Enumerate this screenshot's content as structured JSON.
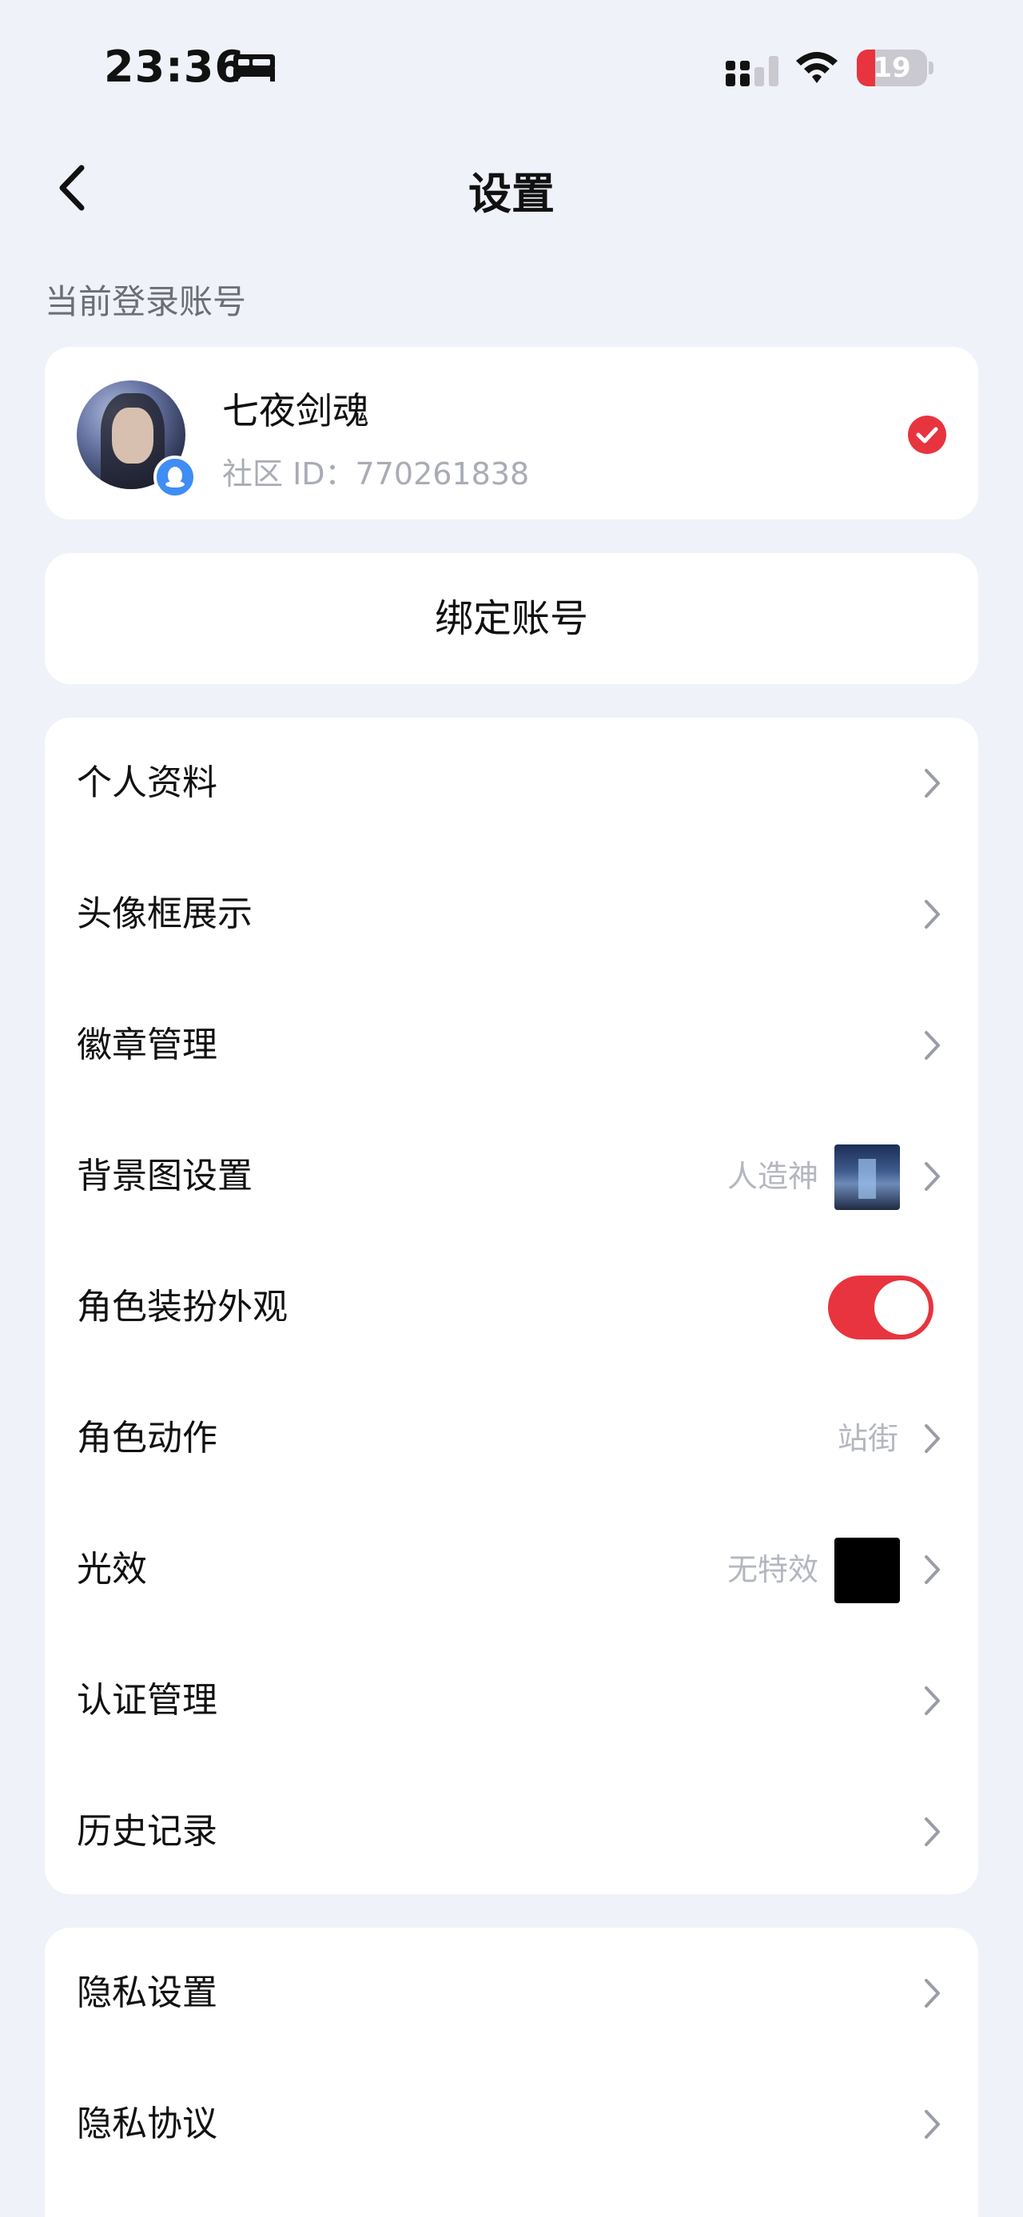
{
  "status_bar": {
    "time": "23:36",
    "battery": "19",
    "battery_level_percent": 19,
    "sleep_icon": "bed-icon",
    "cellular_icon": "cellular-signal-icon",
    "wifi_icon": "wifi-icon"
  },
  "header": {
    "title": "设置",
    "back_icon": "chevron-left-icon"
  },
  "account_section": {
    "label": "当前登录账号",
    "name": "七夜剑魂",
    "id_label": "社区 ID：770261838",
    "selected_icon": "check-circle-icon"
  },
  "bind": {
    "label": "绑定账号"
  },
  "menu": [
    {
      "label": "个人资料"
    },
    {
      "label": "头像框展示"
    },
    {
      "label": "徽章管理"
    },
    {
      "label": "背景图设置",
      "value": "人造神",
      "thumb": "background"
    },
    {
      "label": "角色装扮外观",
      "toggle": true
    },
    {
      "label": "角色动作",
      "value": "站街"
    },
    {
      "label": "光效",
      "value": "无特效",
      "thumb": "black"
    },
    {
      "label": "认证管理"
    },
    {
      "label": "历史记录"
    }
  ],
  "menu2": [
    {
      "label": "隐私设置"
    },
    {
      "label": "隐私协议"
    }
  ],
  "colors": {
    "accent": "#e8343f",
    "background": "#f0f2fa",
    "card": "#ffffff",
    "secondary_text": "#b4b7bf"
  }
}
